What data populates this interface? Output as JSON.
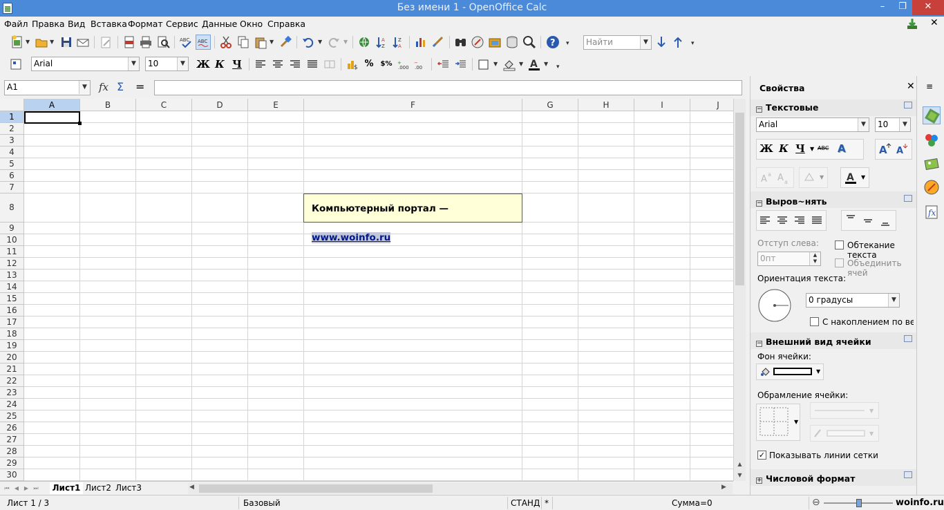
{
  "window": {
    "title": "Без имени 1 - OpenOffice Calc",
    "minimize": "–",
    "maximize": "❐",
    "close": "✕"
  },
  "menu": [
    "Файл",
    "Правка",
    "Вид",
    "Вставка",
    "Формат",
    "Сервис",
    "Данные",
    "Окно",
    "Справка"
  ],
  "toolbar": {
    "find_placeholder": "Найти"
  },
  "format": {
    "font_name": "Arial",
    "font_size": "10",
    "bold": "Ж",
    "italic": "К",
    "underline": "Ч",
    "percent": "%",
    "currency": "$%"
  },
  "formula": {
    "cell_ref": "A1",
    "fx": "fx",
    "sum": "Σ",
    "equals": "=",
    "content": ""
  },
  "grid": {
    "columns": [
      "A",
      "B",
      "C",
      "D",
      "E",
      "F",
      "G",
      "H",
      "I",
      "J"
    ],
    "rows": [
      "1",
      "2",
      "3",
      "4",
      "5",
      "6",
      "7",
      "8",
      "9",
      "10",
      "11",
      "12",
      "13",
      "14",
      "15",
      "16",
      "17",
      "18",
      "19",
      "20",
      "21",
      "22",
      "23",
      "24",
      "25",
      "26",
      "27",
      "28",
      "29",
      "30"
    ],
    "selected_column": "A",
    "selected_row": "1"
  },
  "overlay": {
    "text": "Компьютерный портал — ",
    "link": "www.woinfo.ru"
  },
  "sheets": {
    "tabs": [
      "Лист1",
      "Лист2",
      "Лист3"
    ],
    "active": "Лист1"
  },
  "status": {
    "sheet": "Лист 1 / 3",
    "style": "Базовый",
    "mode": "СТАНД",
    "modified": "*",
    "sum": "Сумма=0",
    "watermark": "woinfo.ru"
  },
  "sidebar": {
    "title": "Свойства",
    "close": "✕",
    "text_section": {
      "title": "Текстовые",
      "font": "Arial",
      "size": "10",
      "bold": "Ж",
      "italic": "К",
      "underline": "Ч",
      "strike": "ABC"
    },
    "align_section": {
      "title": "Выров~нять",
      "indent_label": "Отступ слева:",
      "indent_value": "0пт",
      "wrap_label": "Обтекание текста",
      "merge_label": "Объединить ячей",
      "orientation_label": "Ориентация текста:",
      "orientation_value": "0 градусы",
      "stacked_label": "С накоплением по верти"
    },
    "cell_section": {
      "title": "Внешний вид ячейки",
      "bg_label": "Фон ячейки:",
      "border_label": "Обрамление ячейки:",
      "gridlines_label": "Показывать линии сетки",
      "gridlines_checked": "✓"
    },
    "number_section": {
      "title": "Числовой формат"
    }
  },
  "colors": {
    "titlebar": "#4a8ad8",
    "close": "#c7413a",
    "selection": "#b9d2f0",
    "overlay_bg": "#ffffd8",
    "link": "#001a8c"
  }
}
